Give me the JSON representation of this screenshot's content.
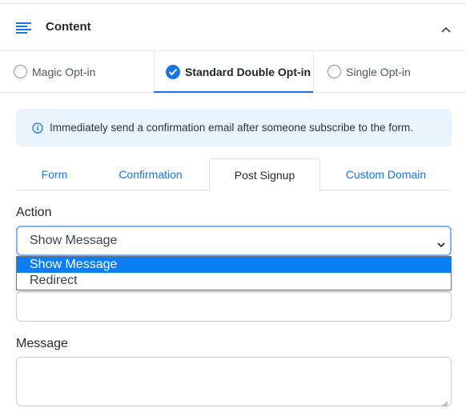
{
  "section": {
    "title": "Content",
    "menu_icon": "menu-lines-icon",
    "collapse_icon": "chevron-up-icon"
  },
  "optin_tabs": [
    {
      "label": "Magic Opt-in",
      "selected": false
    },
    {
      "label": "Standard Double Opt-in",
      "selected": true
    },
    {
      "label": "Single Opt-in",
      "selected": false
    }
  ],
  "info": {
    "icon": "info-circle-icon",
    "text": "Immediately send a confirmation email after someone subscribe to the form."
  },
  "sub_tabs": [
    {
      "label": "Form",
      "active": false
    },
    {
      "label": "Confirmation",
      "active": false
    },
    {
      "label": "Post Signup",
      "active": true
    },
    {
      "label": "Custom Domain",
      "active": false
    }
  ],
  "action": {
    "label": "Action",
    "value": "Show Message",
    "options": [
      "Show Message",
      "Redirect"
    ]
  },
  "message": {
    "label": "Message",
    "value": ""
  },
  "colors": {
    "accent": "#1a73e8",
    "info_bg": "#eaf4fd",
    "option_highlight": "#0a7ff5"
  }
}
